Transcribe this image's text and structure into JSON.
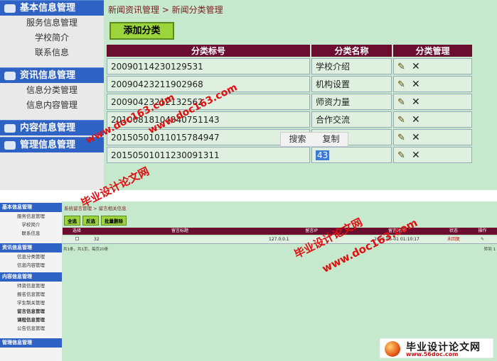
{
  "top": {
    "sidebar": {
      "groups": [
        {
          "title": "基本信息管理",
          "items": [
            "服务信息管理",
            "学校简介",
            "联系信息"
          ]
        },
        {
          "title": "资讯信息管理",
          "items": [
            "信息分类管理",
            "信息内容管理"
          ]
        },
        {
          "title": "内容信息管理",
          "items": []
        },
        {
          "title": "管理信息管理",
          "items": []
        }
      ]
    },
    "breadcrumb": "新闻资讯管理 > 新闻分类管理",
    "add_button": "添加分类",
    "table": {
      "headers": [
        "分类标号",
        "分类名称",
        "分类管理"
      ],
      "rows": [
        {
          "id": "20090114230129531",
          "name": "学校介绍"
        },
        {
          "id": "20090423211902968",
          "name": "机构设置"
        },
        {
          "id": "20090423212132562",
          "name": "师资力量"
        },
        {
          "id": "20100818104340751143",
          "name": "合作交流"
        },
        {
          "id": "20150501011015784947",
          "name": ""
        },
        {
          "id": "20150501011230091311",
          "name": "43"
        }
      ]
    },
    "context_menu": [
      "搜索",
      "复制"
    ]
  },
  "bottom": {
    "sidebar": {
      "groups": [
        {
          "title": "基本信息管理",
          "items": [
            "服务信息管理",
            "学校简介",
            "联系信息"
          ]
        },
        {
          "title": "资讯信息管理",
          "items": [
            "信息分类管理",
            "信息内容管理"
          ]
        },
        {
          "title": "内容信息管理",
          "items": [
            "师资信息管理",
            "报名信息管理",
            "学生制关管理",
            "留言信息管理",
            "课程信息管理",
            "公告信息管理"
          ]
        },
        {
          "title": "管理信息管理",
          "items": []
        }
      ]
    },
    "breadcrumb": "系统留言管理 > 留言相关信息",
    "buttons": [
      "全选",
      "反选",
      "批量删除"
    ],
    "table": {
      "headers": [
        "选择",
        "留言标题",
        "留言IP",
        "留言时间",
        "状态",
        "操作"
      ],
      "row": {
        "title": "32",
        "ip": "127.0.0.1",
        "time": "2015-05-01 01:10:17",
        "status": "未回复"
      }
    },
    "pager": {
      "left": "共1条，共1页，每页20条",
      "right": "转到 1"
    }
  },
  "watermarks": {
    "site": "www.doc163.com",
    "text": "毕业设计论文网",
    "logo_title": "毕业设计论文网",
    "logo_url": "www.56doc.com"
  },
  "colors": {
    "sidebar_blue": "#2f62c5",
    "header_maroon": "#6b0d2f",
    "page_green": "#c6e8cc",
    "button_green": "#9bd53b",
    "watermark_red": "#e01010"
  }
}
